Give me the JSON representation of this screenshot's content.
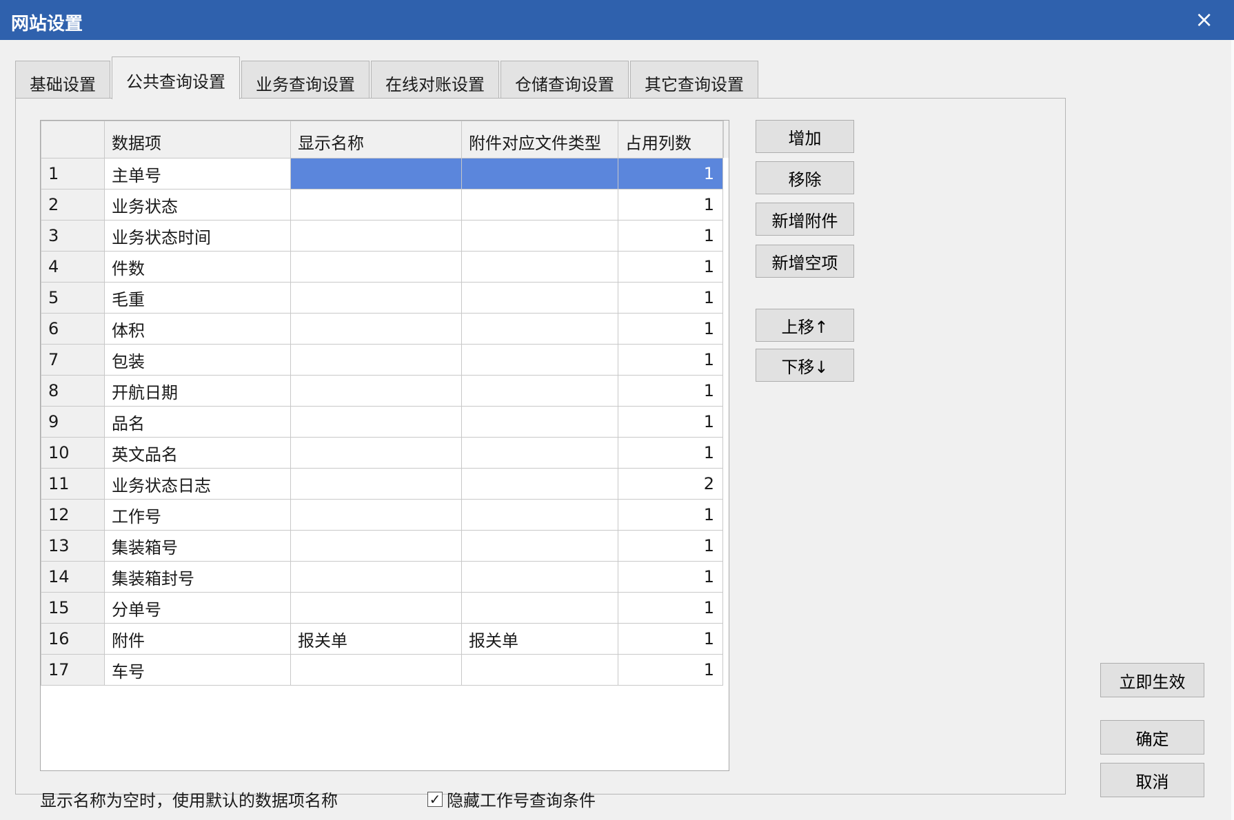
{
  "window": {
    "title": "网站设置",
    "close_icon": "×"
  },
  "tabs": [
    {
      "label": "基础设置"
    },
    {
      "label": "公共查询设置",
      "active": true
    },
    {
      "label": "业务查询设置"
    },
    {
      "label": "在线对账设置"
    },
    {
      "label": "仓储查询设置"
    },
    {
      "label": "其它查询设置"
    }
  ],
  "grid": {
    "columns": [
      "",
      "数据项",
      "显示名称",
      "附件对应文件类型",
      "占用列数"
    ],
    "selected_row": 1,
    "rows": [
      {
        "n": "1",
        "item": "主单号",
        "display": "",
        "filetype": "",
        "cols": "1"
      },
      {
        "n": "2",
        "item": "业务状态",
        "display": "",
        "filetype": "",
        "cols": "1"
      },
      {
        "n": "3",
        "item": "业务状态时间",
        "display": "",
        "filetype": "",
        "cols": "1"
      },
      {
        "n": "4",
        "item": "件数",
        "display": "",
        "filetype": "",
        "cols": "1"
      },
      {
        "n": "5",
        "item": "毛重",
        "display": "",
        "filetype": "",
        "cols": "1"
      },
      {
        "n": "6",
        "item": "体积",
        "display": "",
        "filetype": "",
        "cols": "1"
      },
      {
        "n": "7",
        "item": "包装",
        "display": "",
        "filetype": "",
        "cols": "1"
      },
      {
        "n": "8",
        "item": "开航日期",
        "display": "",
        "filetype": "",
        "cols": "1"
      },
      {
        "n": "9",
        "item": "品名",
        "display": "",
        "filetype": "",
        "cols": "1"
      },
      {
        "n": "10",
        "item": "英文品名",
        "display": "",
        "filetype": "",
        "cols": "1"
      },
      {
        "n": "11",
        "item": "业务状态日志",
        "display": "",
        "filetype": "",
        "cols": "2"
      },
      {
        "n": "12",
        "item": "工作号",
        "display": "",
        "filetype": "",
        "cols": "1"
      },
      {
        "n": "13",
        "item": "集装箱号",
        "display": "",
        "filetype": "",
        "cols": "1"
      },
      {
        "n": "14",
        "item": "集装箱封号",
        "display": "",
        "filetype": "",
        "cols": "1"
      },
      {
        "n": "15",
        "item": "分单号",
        "display": "",
        "filetype": "",
        "cols": "1"
      },
      {
        "n": "16",
        "item": "附件",
        "display": "报关单",
        "filetype": "报关单",
        "cols": "1"
      },
      {
        "n": "17",
        "item": "车号",
        "display": "",
        "filetype": "",
        "cols": "1"
      }
    ]
  },
  "side_buttons": {
    "add": "增加",
    "remove": "移除",
    "add_attachment": "新增附件",
    "add_blank": "新增空项",
    "move_up": "上移↑",
    "move_down": "下移↓"
  },
  "footer": {
    "note": "显示名称为空时，使用默认的数据项名称",
    "checkbox_label": "隐藏工作号查询条件",
    "checkbox_checked": true,
    "checkbox_mark": "✓"
  },
  "dialog_buttons": {
    "apply": "立即生效",
    "ok": "确定",
    "cancel": "取消"
  }
}
